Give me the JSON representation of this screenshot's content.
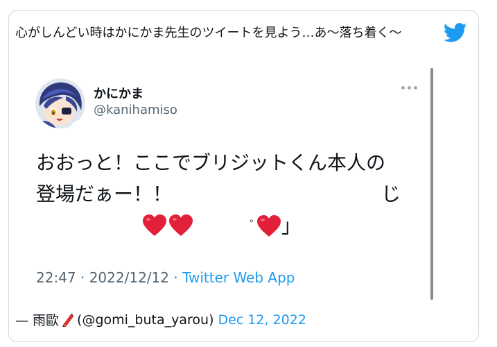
{
  "embed": {
    "outer_text": "心がしんどい時はかにかま先生のツイートを見よう…あ〜落ち着く〜",
    "quoted_tweet": {
      "display_name": "かにかま",
      "handle": "@kanihamiso",
      "text_line1": "おおっと！ここでブリジットくん本人の",
      "text_line2": "登場だぁー！！",
      "text_line2_tail": "じ",
      "text_fragment_small": "ﾞ",
      "text_fragment_end": "」",
      "timestamp": "22:47 · 2022/12/12 · ",
      "source": "Twitter Web App"
    },
    "footer": {
      "prefix": "— 雨歐",
      "handle": "(@gomi_buta_yarou)",
      "date": "Dec 12, 2022"
    }
  },
  "colors": {
    "link": "#1d9bf0",
    "twitter_blue": "#1d9bf0",
    "heart_red": "#e3203a",
    "muted": "#536471"
  },
  "icons": {
    "brand": "twitter-bird-icon",
    "more": "more-dots-icon",
    "heart": "red-heart-emoji",
    "umbrella": "closed-umbrella-emoji"
  }
}
